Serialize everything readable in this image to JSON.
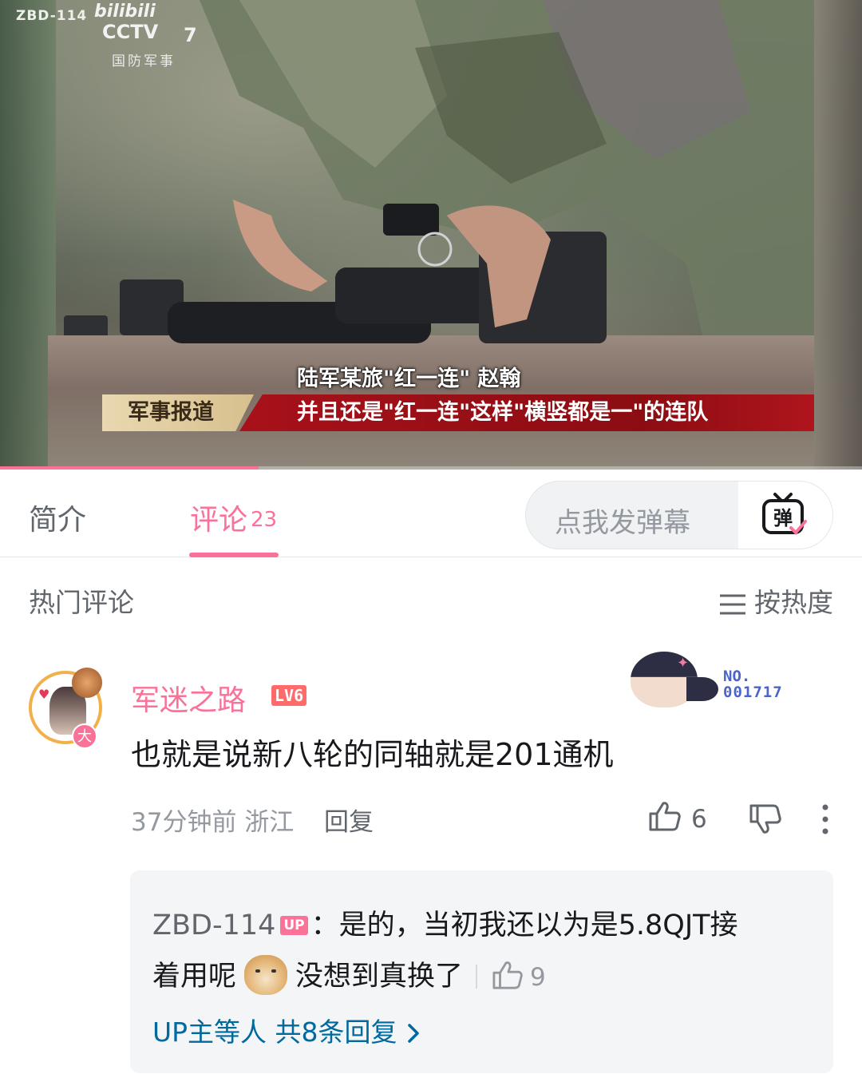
{
  "video": {
    "watermark_id": "ZBD-114",
    "bili_logo": "bilibili",
    "cctv_logo": "CCTV",
    "cctv_channel": "7",
    "cctv_subtitle": "国防军事",
    "speaker_caption": "陆军某旅\"红一连\" 赵翰",
    "news_tag": "军事报道",
    "subtitle": "并且还是\"红一连\"这样\"横竖都是一\"的连队",
    "progress_fraction": 0.3
  },
  "tabs": {
    "intro_label": "简介",
    "comments_label": "评论",
    "comments_count": "23",
    "danmaku_placeholder": "点我发弹幕",
    "danmaku_icon": "danmaku-send-icon"
  },
  "comments_header": {
    "title": "热门评论",
    "sort_label": "按热度"
  },
  "comment": {
    "username": "军迷之路",
    "level": "LV6",
    "avatar_badge": "大",
    "fan_badge_label": "NO.",
    "fan_badge_number": "001717",
    "content": "也就是说新八轮的同轴就是201通机",
    "time": "37分钟前",
    "location": "浙江",
    "reply_label": "回复",
    "likes": "6",
    "replies": {
      "user": "ZBD-114",
      "up_tag": "UP",
      "text_part1": "：是的，当初我还以为是5.8QJT接",
      "text_part2_before_emoji": "着用呢",
      "text_part2_after_emoji": "没想到真换了",
      "likes": "9",
      "more_text": "UP主等人 共8条回复"
    }
  },
  "colors": {
    "accent_pink": "#fb7299",
    "link_blue": "#00699d",
    "text_primary": "#18191c",
    "text_secondary": "#61666d",
    "text_muted": "#9499a0"
  }
}
